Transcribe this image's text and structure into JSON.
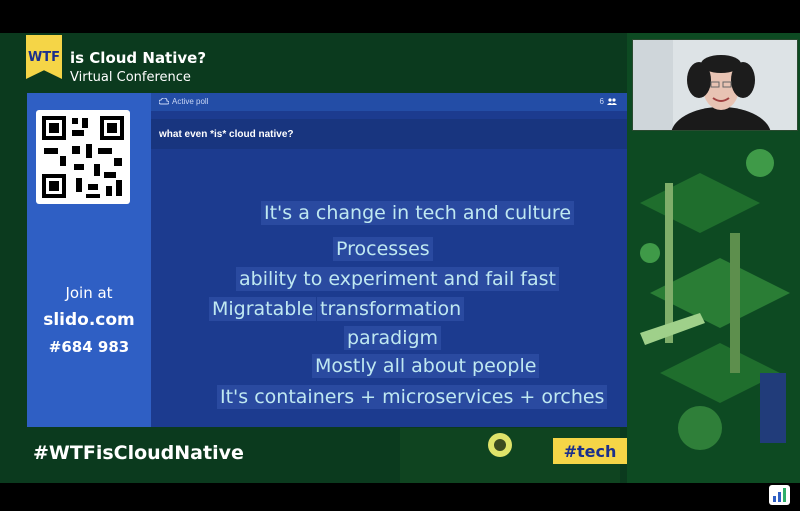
{
  "brand": {
    "logo_text": "WTF",
    "conference_title": "is Cloud Native?",
    "conference_subtitle": "Virtual Conference"
  },
  "slido": {
    "join_label": "Join at",
    "join_site": "slido.com",
    "event_code": "#684 983",
    "poll_status": "Active poll",
    "participant_count": "6",
    "question": "what even *is* cloud native?",
    "answers": [
      "It's a change in tech and culture",
      "Processes",
      "ability to experiment and fail fast",
      "Migratable",
      "transformation",
      "paradigm",
      "Mostly all about people",
      "It's containers + microservices + orches"
    ]
  },
  "footer": {
    "hashtag": "#WTFisCloudNative",
    "track": "#tech"
  },
  "colors": {
    "background": "#0b3a1e",
    "accent_yellow": "#f5d547",
    "slido_blue": "#234da6",
    "answer_text": "#bfe8f1"
  },
  "icons": [
    "qr-code-icon",
    "poll-icon",
    "participants-icon",
    "webcam-video",
    "slido-corner-logo"
  ]
}
